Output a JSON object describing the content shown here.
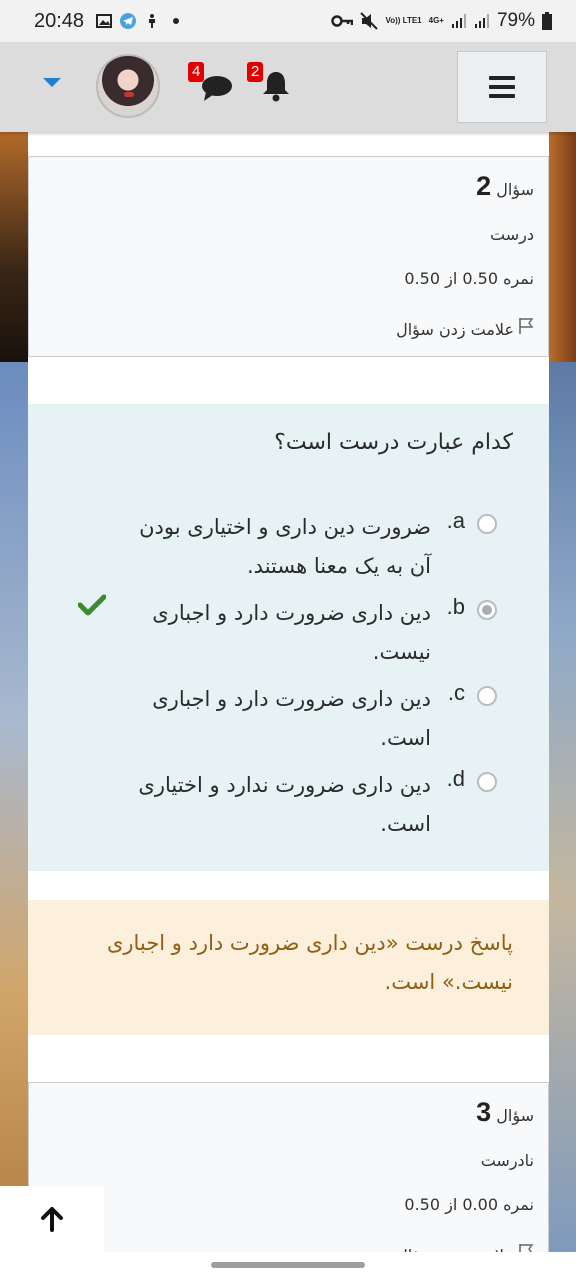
{
  "status_bar": {
    "time": "20:48",
    "network_labels": [
      "Vo)) LTE1",
      "4G+"
    ],
    "battery": "79%"
  },
  "header": {
    "messages_badge": "4",
    "notifications_badge": "2"
  },
  "question2_info": {
    "label": "سؤال",
    "number": "2",
    "state": "درست",
    "grade": "نمره 0.50 از 0.50",
    "flag_label": "علامت زدن سؤال"
  },
  "question": {
    "text": "کدام عبارت درست است؟",
    "options": [
      {
        "letter": "a.",
        "text": "ضرورت دین داری و اختیاری بودن آن به یک معنا هستند.",
        "selected": false
      },
      {
        "letter": "b.",
        "text": "دین داری ضرورت دارد و اجباری نیست.",
        "selected": true
      },
      {
        "letter": "c.",
        "text": "دین داری ضرورت دارد و اجباری است.",
        "selected": false
      },
      {
        "letter": "d.",
        "text": "دین داری ضرورت ندارد و اختیاری است.",
        "selected": false
      }
    ]
  },
  "feedback": {
    "text": "پاسخ درست «دین داری ضرورت دارد و اجباری نیست.» است."
  },
  "question3_info": {
    "label": "سؤال",
    "number": "3",
    "state": "نادرست",
    "grade": "نمره 0.00 از 0.50",
    "flag_label": "علامت زدن سؤال"
  },
  "colors": {
    "accent": "#1f7fd1",
    "badge": "#e30000",
    "correct_tick": "#3a8a2e",
    "feedback_bg": "#fcefdc",
    "question_bg": "#e7f2f4"
  }
}
